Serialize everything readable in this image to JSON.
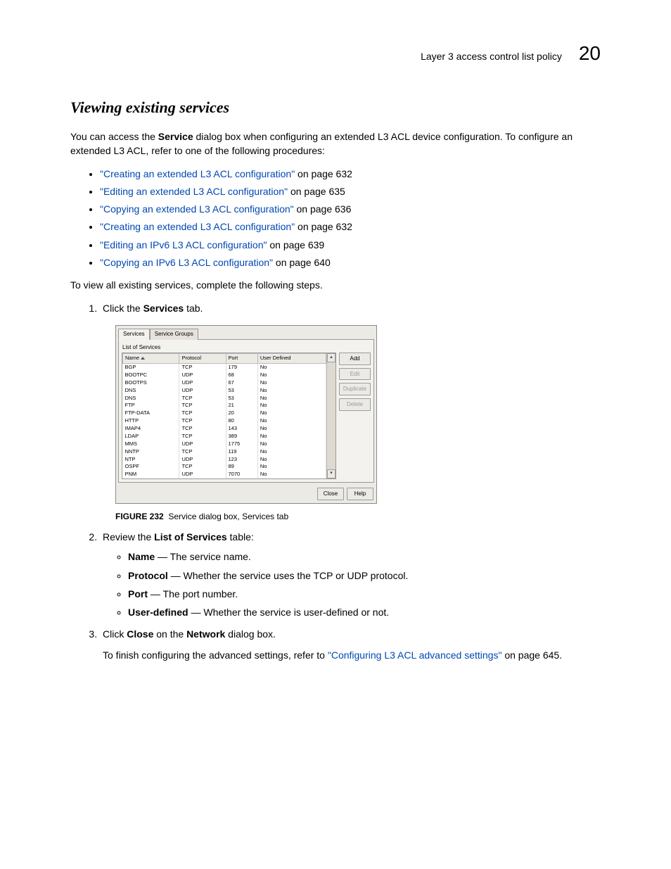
{
  "header": {
    "section": "Layer 3 access control list policy",
    "chapter": "20"
  },
  "title": "Viewing existing services",
  "intro": {
    "p1a": "You can access the ",
    "p1b": "Service",
    "p1c": " dialog box when configuring an extended L3 ACL device configuration. To configure an extended L3 ACL, refer to one of the following procedures:"
  },
  "links": [
    {
      "text": "\"Creating an extended L3 ACL configuration\"",
      "tail": " on page 632"
    },
    {
      "text": "\"Editing an extended L3 ACL configuration\"",
      "tail": " on page 635"
    },
    {
      "text": "\"Copying an extended L3 ACL configuration\"",
      "tail": " on page 636"
    },
    {
      "text": "\"Creating an extended L3 ACL configuration\"",
      "tail": " on page 632"
    },
    {
      "text": "\"Editing an IPv6 L3 ACL configuration\"",
      "tail": " on page 639"
    },
    {
      "text": "\"Copying an IPv6 L3 ACL configuration\"",
      "tail": " on page 640"
    }
  ],
  "lead2": "To view all existing services, complete the following steps.",
  "step1": {
    "a": "Click the ",
    "b": "Services",
    "c": " tab."
  },
  "dialog": {
    "tabs": {
      "services": "Services",
      "groups": "Service Groups"
    },
    "list_label": "List of Services",
    "cols": {
      "name": "Name",
      "protocol": "Protocol",
      "port": "Port",
      "userdef": "User Defined"
    },
    "rows": [
      {
        "name": "BGP",
        "protocol": "TCP",
        "port": "179",
        "userdef": "No"
      },
      {
        "name": "BOOTPC",
        "protocol": "UDP",
        "port": "68",
        "userdef": "No"
      },
      {
        "name": "BOOTPS",
        "protocol": "UDP",
        "port": "67",
        "userdef": "No"
      },
      {
        "name": "DNS",
        "protocol": "UDP",
        "port": "53",
        "userdef": "No"
      },
      {
        "name": "DNS",
        "protocol": "TCP",
        "port": "53",
        "userdef": "No"
      },
      {
        "name": "FTP",
        "protocol": "TCP",
        "port": "21",
        "userdef": "No"
      },
      {
        "name": "FTP-DATA",
        "protocol": "TCP",
        "port": "20",
        "userdef": "No"
      },
      {
        "name": "HTTP",
        "protocol": "TCP",
        "port": "80",
        "userdef": "No"
      },
      {
        "name": "IMAP4",
        "protocol": "TCP",
        "port": "143",
        "userdef": "No"
      },
      {
        "name": "LDAP",
        "protocol": "TCP",
        "port": "389",
        "userdef": "No"
      },
      {
        "name": "MMS",
        "protocol": "UDP",
        "port": "1775",
        "userdef": "No"
      },
      {
        "name": "NNTP",
        "protocol": "TCP",
        "port": "119",
        "userdef": "No"
      },
      {
        "name": "NTP",
        "protocol": "UDP",
        "port": "123",
        "userdef": "No"
      },
      {
        "name": "OSPF",
        "protocol": "TCP",
        "port": "89",
        "userdef": "No"
      },
      {
        "name": "PNM",
        "protocol": "UDP",
        "port": "7070",
        "userdef": "No"
      }
    ],
    "buttons": {
      "add": "Add",
      "edit": "Edit",
      "duplicate": "Duplicate",
      "delete": "Delete",
      "close": "Close",
      "help": "Help"
    }
  },
  "figure": {
    "label": "FIGURE 232",
    "caption": "Service dialog box, Services tab"
  },
  "step2": {
    "a": "Review the ",
    "b": "List of Services",
    "c": " table:",
    "items": [
      {
        "b": "Name",
        "t": " — The service name."
      },
      {
        "b": "Protocol",
        "t": " — Whether the service uses the TCP or UDP protocol."
      },
      {
        "b": "Port",
        "t": " — The port number."
      },
      {
        "b": "User-defined",
        "t": " — Whether the service is user-defined or not."
      }
    ]
  },
  "step3": {
    "a": "Click ",
    "b": "Close",
    "c": " on the ",
    "d": "Network",
    "e": " dialog box.",
    "p2a": "To finish configuring the advanced settings, refer to ",
    "p2link": "\"Configuring L3 ACL advanced settings\"",
    "p2b": " on page 645."
  }
}
